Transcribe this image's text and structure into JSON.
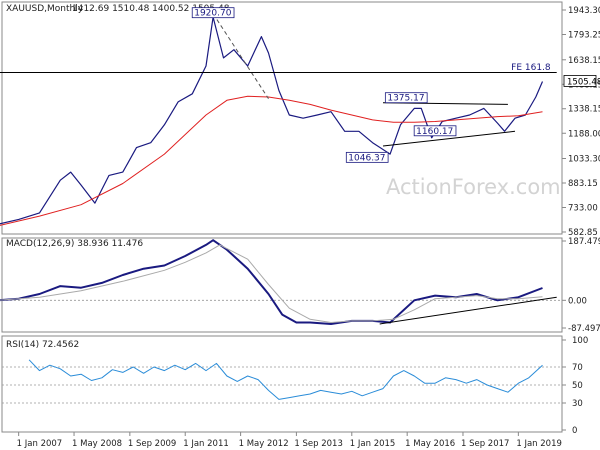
{
  "chart_data": [
    {
      "type": "line",
      "panel": "price",
      "title": "XAUUSD,Monthly",
      "ohlc_text": "1412.69 1510.48 1400.52 1505.48",
      "ylim": [
        582.85,
        2000
      ],
      "y_ticks": [
        "1943.30",
        "1793.25",
        "1638.15",
        "1488.15",
        "1338.15",
        "1188.00",
        "1033.30",
        "883.15",
        "733.00",
        "582.85"
      ],
      "y_tick_values": [
        1943.3,
        1793.25,
        1638.15,
        1488.15,
        1338.15,
        1188.0,
        1033.3,
        883.15,
        733.0,
        582.85
      ],
      "last_price": "1505.48",
      "x_ticks": [
        "1 Jan 2007",
        "1 May 2008",
        "1 Sep 2009",
        "1 Jan 2011",
        "1 May 2012",
        "1 Sep 2013",
        "1 Jan 2015",
        "1 May 2016",
        "1 Sep 2017",
        "1 Jan 2019"
      ],
      "annotations": [
        {
          "text": "1920.70",
          "x": 2011.67,
          "y": 1920.7
        },
        {
          "text": "1375.17",
          "x": 2016.5,
          "y": 1375.17
        },
        {
          "text": "1160.17",
          "x": 2017.0,
          "y": 1160.17
        },
        {
          "text": "1046.37",
          "x": 2015.92,
          "y": 1046.37
        },
        {
          "text": "FE 161.8",
          "x": 2019.5,
          "y": 1550
        }
      ],
      "series": [
        {
          "color": "#1a1a80",
          "x": [
            2006.5,
            2007.0,
            2007.5,
            2008.0,
            2008.25,
            2008.5,
            2008.83,
            2009.17,
            2009.5,
            2009.83,
            2010.17,
            2010.5,
            2010.83,
            2011.17,
            2011.5,
            2011.67,
            2011.92,
            2012.17,
            2012.5,
            2012.83,
            2013.0,
            2013.25,
            2013.5,
            2013.83,
            2014.17,
            2014.5,
            2014.83,
            2015.17,
            2015.5,
            2015.92,
            2016.17,
            2016.5,
            2016.67,
            2016.92,
            2017.17,
            2017.5,
            2017.83,
            2018.17,
            2018.5,
            2018.67,
            2018.92,
            2019.17,
            2019.42,
            2019.58
          ],
          "y": [
            630,
            660,
            700,
            900,
            950,
            870,
            760,
            930,
            950,
            1100,
            1130,
            1240,
            1380,
            1430,
            1600,
            1900,
            1650,
            1700,
            1600,
            1780,
            1680,
            1450,
            1300,
            1280,
            1300,
            1320,
            1200,
            1200,
            1130,
            1060,
            1240,
            1340,
            1340,
            1160,
            1260,
            1280,
            1300,
            1340,
            1250,
            1200,
            1280,
            1300,
            1410,
            1505
          ]
        },
        {
          "name": "MA",
          "color": "#e02020",
          "x": [
            2006.5,
            2007.5,
            2008.5,
            2009.5,
            2010.5,
            2011.5,
            2012.0,
            2012.5,
            2013.0,
            2013.5,
            2014.0,
            2014.5,
            2015.0,
            2015.5,
            2016.0,
            2016.5,
            2017.0,
            2017.5,
            2018.0,
            2018.5,
            2019.0,
            2019.58
          ],
          "y": [
            620,
            680,
            750,
            880,
            1060,
            1300,
            1390,
            1415,
            1410,
            1390,
            1365,
            1330,
            1300,
            1270,
            1255,
            1255,
            1260,
            1270,
            1280,
            1290,
            1295,
            1320
          ]
        },
        {
          "name": "dashed-trend",
          "color": "#555555",
          "dash": true,
          "x": [
            2011.67,
            2013.0
          ],
          "y": [
            1920.7,
            1400
          ]
        },
        {
          "name": "upper-channel",
          "color": "#000000",
          "x": [
            2015.75,
            2018.75
          ],
          "y": [
            1375.17,
            1365
          ]
        },
        {
          "name": "lower-channel",
          "color": "#000000",
          "x": [
            2015.75,
            2018.92
          ],
          "y": [
            1110,
            1200
          ]
        },
        {
          "name": "fe-line",
          "color": "#000000",
          "x": [
            2006.5,
            2019.92
          ],
          "y": [
            1560,
            1560
          ]
        }
      ]
    },
    {
      "type": "line",
      "panel": "macd",
      "title": "MACD(12,26,9) 38.936 11.476",
      "ylim": [
        -100,
        200
      ],
      "y_ticks": [
        "187.479",
        "0.00",
        "-87.497"
      ],
      "y_tick_values": [
        187.479,
        0,
        -87.497
      ],
      "series": [
        {
          "color": "#1a1a80",
          "x": [
            2006.5,
            2007.0,
            2007.5,
            2008.0,
            2008.5,
            2009.0,
            2009.5,
            2010.0,
            2010.5,
            2011.0,
            2011.5,
            2011.67,
            2012.0,
            2012.5,
            2013.0,
            2013.33,
            2013.67,
            2014.0,
            2014.5,
            2015.0,
            2015.5,
            2015.92,
            2016.5,
            2017.0,
            2017.5,
            2018.0,
            2018.5,
            2019.0,
            2019.58
          ],
          "y": [
            0,
            5,
            20,
            45,
            40,
            55,
            80,
            100,
            110,
            140,
            175,
            190,
            160,
            100,
            20,
            -45,
            -70,
            -70,
            -75,
            -65,
            -65,
            -70,
            0,
            15,
            10,
            20,
            0,
            10,
            39
          ]
        },
        {
          "color": "#aaaaaa",
          "x": [
            2006.5,
            2007.5,
            2008.5,
            2009.5,
            2010.5,
            2011.0,
            2011.5,
            2011.83,
            2012.5,
            2013.0,
            2013.5,
            2014.0,
            2014.5,
            2015.0,
            2015.5,
            2016.0,
            2016.5,
            2017.0,
            2017.5,
            2018.0,
            2018.5,
            2019.0,
            2019.58
          ],
          "y": [
            0,
            10,
            30,
            60,
            95,
            120,
            150,
            175,
            130,
            50,
            -25,
            -60,
            -70,
            -65,
            -65,
            -60,
            -30,
            5,
            10,
            15,
            5,
            5,
            11
          ]
        },
        {
          "color": "#000000",
          "x": [
            2015.67,
            2019.92
          ],
          "y": [
            -75,
            10
          ]
        }
      ]
    },
    {
      "type": "line",
      "panel": "rsi",
      "title": "RSI(14) 72.4562",
      "ylim": [
        0,
        100
      ],
      "y_ticks": [
        "100",
        "70",
        "50",
        "30",
        "0"
      ],
      "y_tick_values": [
        100,
        70,
        50,
        30,
        0
      ],
      "series": [
        {
          "color": "#2a8cd8",
          "x": [
            2007.25,
            2007.5,
            2007.75,
            2008.0,
            2008.25,
            2008.5,
            2008.75,
            2009.0,
            2009.25,
            2009.5,
            2009.75,
            2010.0,
            2010.25,
            2010.5,
            2010.75,
            2011.0,
            2011.25,
            2011.5,
            2011.75,
            2012.0,
            2012.25,
            2012.5,
            2012.75,
            2013.0,
            2013.25,
            2013.5,
            2013.75,
            2014.0,
            2014.25,
            2014.5,
            2014.75,
            2015.0,
            2015.25,
            2015.5,
            2015.75,
            2016.0,
            2016.25,
            2016.5,
            2016.75,
            2017.0,
            2017.25,
            2017.5,
            2017.75,
            2018.0,
            2018.25,
            2018.5,
            2018.75,
            2019.0,
            2019.25,
            2019.58
          ],
          "y": [
            78,
            66,
            72,
            68,
            60,
            62,
            55,
            58,
            67,
            64,
            70,
            63,
            70,
            66,
            72,
            67,
            74,
            66,
            74,
            60,
            54,
            60,
            56,
            44,
            34,
            36,
            38,
            40,
            44,
            42,
            40,
            43,
            38,
            42,
            46,
            60,
            66,
            60,
            52,
            52,
            58,
            56,
            52,
            56,
            50,
            46,
            42,
            52,
            58,
            72
          ]
        }
      ]
    }
  ],
  "watermark": "ActionForex.com"
}
